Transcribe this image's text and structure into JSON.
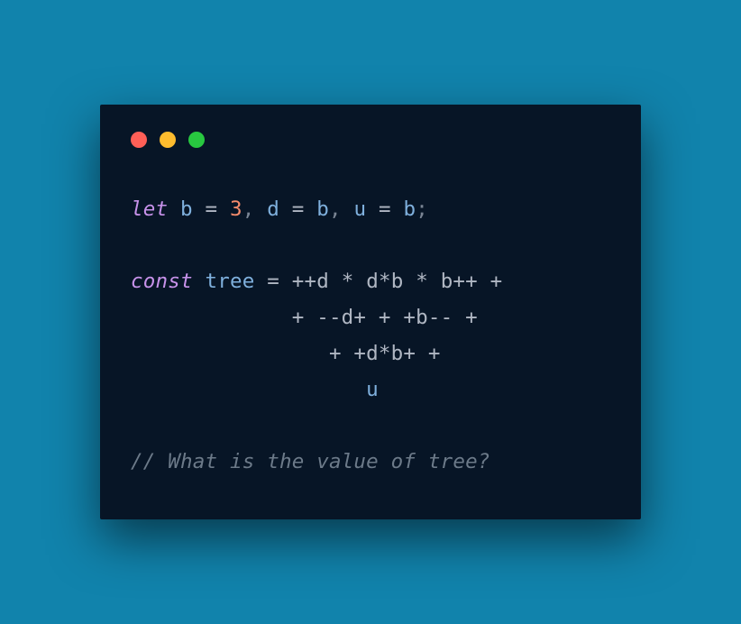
{
  "window": {
    "traffic": [
      "close",
      "minimize",
      "zoom"
    ]
  },
  "code": {
    "line1": {
      "let": "let",
      "b": "b",
      "eq": " = ",
      "three": "3",
      "c1": ", ",
      "d": "d",
      "eq2": " = ",
      "b2": "b",
      "c2": ", ",
      "u": "u",
      "eq3": " = ",
      "b3": "b",
      "semi": ";"
    },
    "blank1": " ",
    "line2": {
      "const": "const",
      "sp": " ",
      "tree": "tree",
      "eq": " = ",
      "expr": "++d * d*b * b++ +"
    },
    "line3": "             + --d+ + +b-- +",
    "line4": "                + +d*b+ +",
    "line5": "                   u",
    "blank2": " ",
    "comment": "// What is the value of tree?"
  }
}
